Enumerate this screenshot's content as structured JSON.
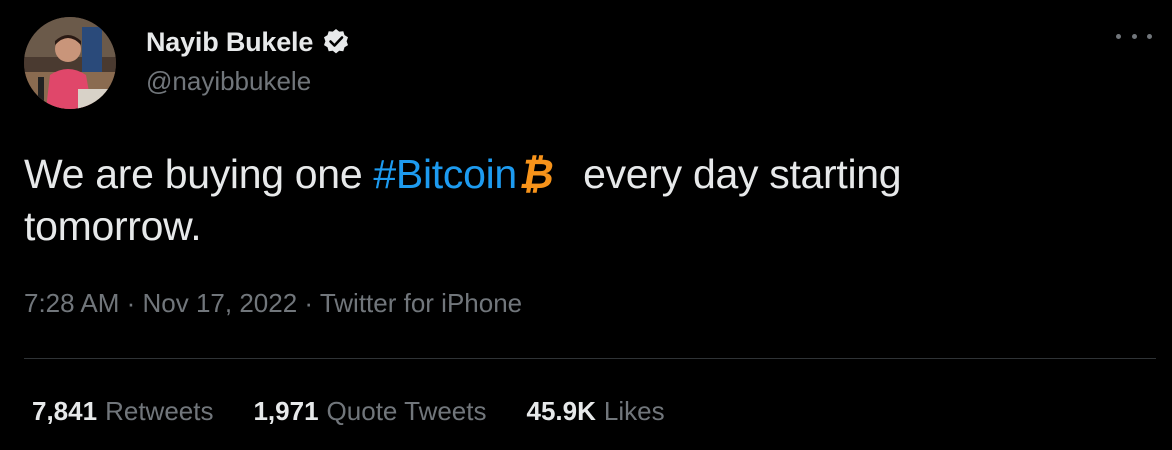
{
  "author": {
    "name": "Nayib Bukele",
    "handle": "@nayibbukele",
    "verified": true,
    "avatar_icon": "profile-photo"
  },
  "tweet": {
    "text_before": "We are buying one ",
    "hashtag": "#Bitcoin",
    "bitcoin_symbol": "₿",
    "text_after": " every day starting tomorrow."
  },
  "meta": {
    "time": "7:28 AM",
    "separator": " · ",
    "date": "Nov 17, 2022",
    "source": "Twitter for iPhone"
  },
  "stats": {
    "retweets_count": "7,841",
    "retweets_label": "Retweets",
    "quotes_count": "1,971",
    "quotes_label": "Quote Tweets",
    "likes_count": "45.9K",
    "likes_label": "Likes"
  },
  "colors": {
    "background": "#000000",
    "text": "#e7e9ea",
    "secondary": "#71767b",
    "link": "#1d9bf0",
    "bitcoin": "#f7931a",
    "divider": "#2f3336"
  },
  "icons": {
    "verified": "verified-badge-icon",
    "more": "more-options-icon"
  }
}
